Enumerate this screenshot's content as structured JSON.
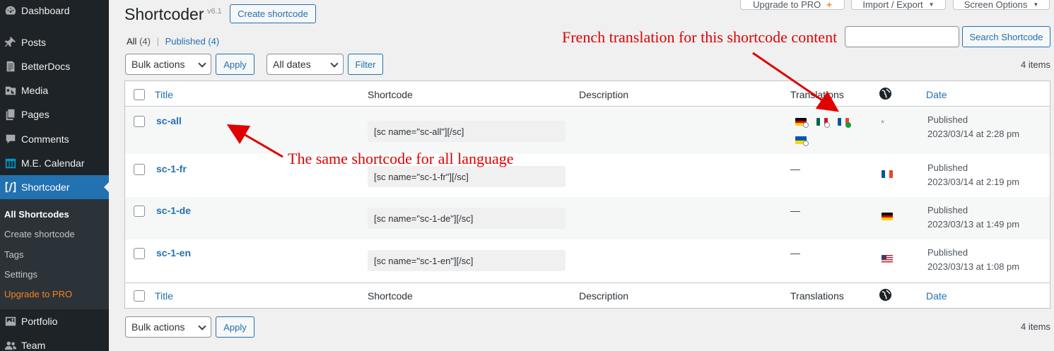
{
  "sidebar": {
    "items": [
      {
        "label": "Dashboard",
        "icon": "dashboard-icon"
      },
      {
        "label": "Posts",
        "icon": "pin-icon"
      },
      {
        "label": "BetterDocs",
        "icon": "docs-icon"
      },
      {
        "label": "Media",
        "icon": "media-icon"
      },
      {
        "label": "Pages",
        "icon": "pages-icon"
      },
      {
        "label": "Comments",
        "icon": "comment-icon"
      },
      {
        "label": "M.E. Calendar",
        "icon": "calendar-icon"
      },
      {
        "label": "Shortcoder",
        "icon": "shortcoder-icon"
      },
      {
        "label": "Portfolio",
        "icon": "portfolio-icon"
      },
      {
        "label": "Team",
        "icon": "team-icon"
      }
    ],
    "submenu": [
      "All Shortcodes",
      "Create shortcode",
      "Tags",
      "Settings",
      "Upgrade to PRO"
    ]
  },
  "header": {
    "title": "Shortcoder",
    "version": "v6.1",
    "create_button": "Create shortcode",
    "upgrade_button": "Upgrade to PRO",
    "import_button": "Import / Export",
    "screen_options": "Screen Options"
  },
  "views": {
    "all": "All",
    "all_count": "(4)",
    "published": "Published",
    "published_count": "(4)"
  },
  "toolbar": {
    "bulk_actions": "Bulk actions",
    "apply": "Apply",
    "all_dates": "All dates",
    "filter": "Filter",
    "search_button": "Search Shortcode",
    "items_count": "4 items"
  },
  "table": {
    "columns": {
      "title": "Title",
      "shortcode": "Shortcode",
      "description": "Description",
      "translations": "Translations",
      "date": "Date"
    },
    "rows": [
      {
        "title": "sc-all",
        "shortcode": "[sc name=\"sc-all\"][/sc]",
        "translations": "",
        "language": "*",
        "status": "Published",
        "date": "2023/03/14 at 2:28 pm"
      },
      {
        "title": "sc-1-fr",
        "shortcode": "[sc name=\"sc-1-fr\"][/sc]",
        "translations": "—",
        "language": "fr",
        "status": "Published",
        "date": "2023/03/14 at 2:19 pm"
      },
      {
        "title": "sc-1-de",
        "shortcode": "[sc name=\"sc-1-de\"][/sc]",
        "translations": "—",
        "language": "de",
        "status": "Published",
        "date": "2023/03/13 at 1:49 pm"
      },
      {
        "title": "sc-1-en",
        "shortcode": "[sc name=\"sc-1-en\"][/sc]",
        "translations": "—",
        "language": "en",
        "status": "Published",
        "date": "2023/03/13 at 1:08 pm"
      }
    ]
  },
  "annotations": {
    "french": "French translation for this shortcode content",
    "same": "The same shortcode for all language"
  },
  "colors": {
    "accent": "#2271b1",
    "annotation": "#e00000",
    "sidebar": "#1d2327"
  }
}
